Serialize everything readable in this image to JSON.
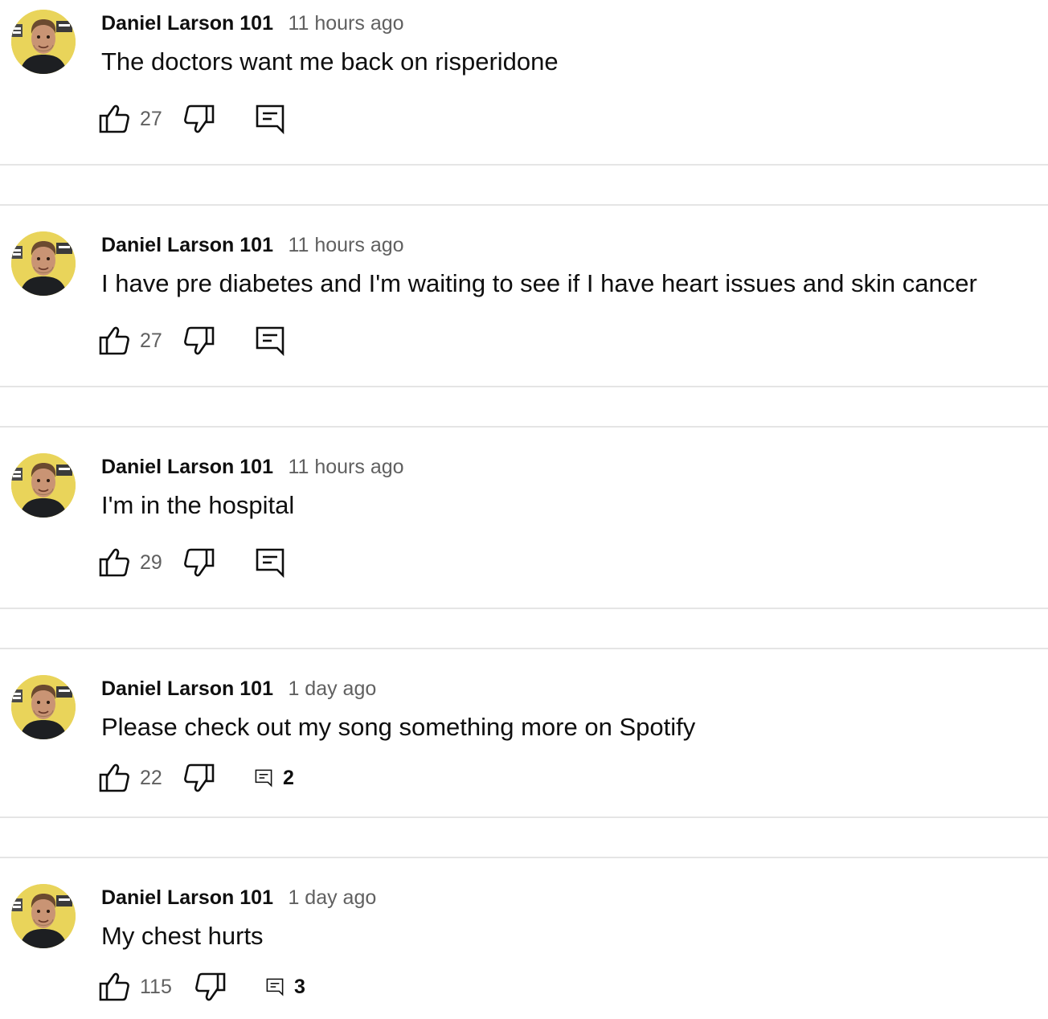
{
  "comments": [
    {
      "author": "Daniel Larson 101",
      "timestamp": "11 hours ago",
      "text": "The doctors want me back on risperidone",
      "likes": "27",
      "replies": ""
    },
    {
      "author": "Daniel Larson 101",
      "timestamp": "11 hours ago",
      "text": "I have pre diabetes and I'm waiting to see if I have heart issues and skin cancer",
      "likes": "27",
      "replies": ""
    },
    {
      "author": "Daniel Larson 101",
      "timestamp": "11 hours ago",
      "text": "I'm in the hospital",
      "likes": "29",
      "replies": ""
    },
    {
      "author": "Daniel Larson 101",
      "timestamp": "1 day ago",
      "text": "Please check out my song something more on Spotify",
      "likes": "22",
      "replies": "2"
    },
    {
      "author": "Daniel Larson 101",
      "timestamp": "1 day ago",
      "text": "My chest hurts",
      "likes": "115",
      "replies": "3"
    }
  ],
  "icons": {
    "like": "thumbs-up-icon",
    "dislike": "thumbs-down-icon",
    "reply": "comment-icon"
  },
  "colors": {
    "text": "#0f0f0f",
    "secondary_text": "#606060",
    "divider": "#e5e5e5",
    "avatar_background": "#e9d45a"
  }
}
